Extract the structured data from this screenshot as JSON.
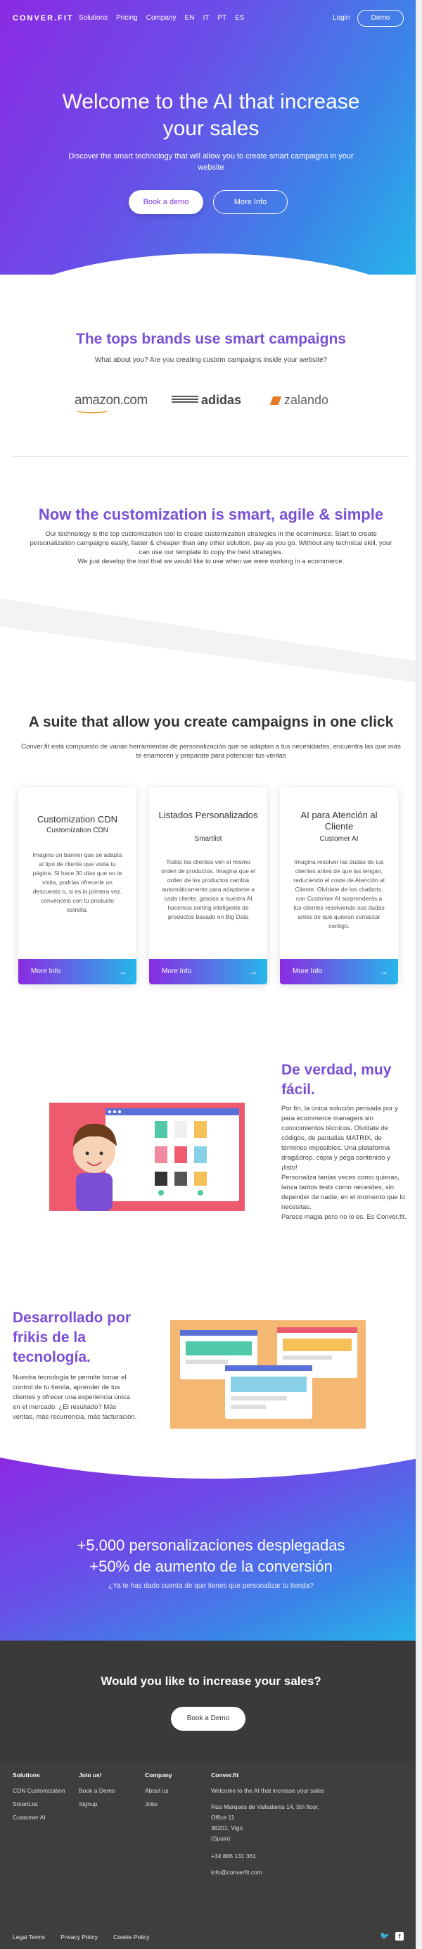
{
  "nav": {
    "logo": "CONVER.FIT",
    "links": [
      "Solutions",
      "Pricing",
      "Company",
      "EN",
      "IT",
      "PT",
      "ES"
    ],
    "login": "Login",
    "demo": "Demo"
  },
  "hero": {
    "title": "Welcome to the AI that increase your sales",
    "subtitle": "Discover the smart technology that will allow you to create smart campaigns in your website",
    "primary_button": "Book a demo",
    "secondary_button": "More Info"
  },
  "brands": {
    "title": "The tops brands use smart campaigns",
    "subtitle": "What about you? Are you creating custom campaigns inside your website?",
    "logos": [
      "amazon.com",
      "adidas",
      "zalando"
    ]
  },
  "customization": {
    "title": "Now the customization is smart, agile & simple",
    "text": "Our technology is the top customization tool to create customization strategies in the ecommerce. Start to create personalization campaigns easily, faster & cheaper than any other solution, pay as you go. Without any technical skill, your can use our template to copy the best strategies.",
    "text2": "We just develop the tool that we would like to use when we were working in a ecommerce."
  },
  "suite": {
    "title": "A suite that allow you create campaigns in one click",
    "subtitle": "Conver.fit está compuesto de varias herramientas de personalización que se adaptan a tus necesidades, encuentra las que más te enamoren y preparate para potenciar tus ventas",
    "cards": [
      {
        "title": "Customization CDN",
        "subtitle": "Customization CDN",
        "text": "Imagina un banner que se adapta al tipo de cliente que visita tu página. Si hace 30 días que no te visita, podrías ofrecerle un descuento o, si es la primera vez, convéncelo con tu producto estrella.",
        "button": "More Info"
      },
      {
        "title": "Listados Personalizados",
        "subtitle": "Smartlist",
        "text": "Todos los clientes ven el mismo orden de productos. Imagina que el orden de los productos cambia automáticamente para adaptarse a cada cliente, gracias a nuestra AI hacemos sorting inteligente de productos basado en Big Data",
        "button": "More Info"
      },
      {
        "title": "AI para Atención al Cliente",
        "subtitle": "Customer AI",
        "text": "Imagina resolver las dudas de tus clientes antes de que las tengan, reduciendo el coste de Atención al Cliente. Olvídate de los chatbots, con Customer AI sorprenderás a tus clientes resolviendo sus dudas antes de que quieran contactar contigo.",
        "button": "More Info"
      }
    ]
  },
  "easy": {
    "title": "De verdad, muy fácil.",
    "p1": "Por fin, la única solución pensada por y para ecommerce managers sin conocimientos técnicos. Olvídate de códigos, de pantallas MATRIX, de términos imposibles. Una plataforma drag&drop, copia y pega contenido y ¡listo!",
    "p2": "Personaliza tantas veces como quieras, lanza tantos tests como necesites, sin depender de nadie, en el momento que lo necesitas.",
    "p3": "Parece magia pero no lo es. Es Conver.fit."
  },
  "geeks": {
    "title": "Desarrollado por frikis de la tecnología.",
    "text": "Nuestra tecnología te permite tomar el control de tu tienda, aprender de tus clientes y ofrecer una experiencia única en el mercado. ¿El resultado? Más ventas, más recurrencia, más facturación."
  },
  "stats": {
    "line1": "+5.000 personalizaciones desplegadas",
    "line2": "+50% de aumento de la conversión",
    "sub": "¿Ya te has dado cuenta de que tienes que personalizar tu tienda?"
  },
  "cta": {
    "title": "Would you like to increase your sales?",
    "button": "Book a Demo"
  },
  "footer": {
    "solutions": {
      "heading": "Solutions",
      "items": [
        "CDN Customization",
        "SmartList",
        "Customer AI"
      ]
    },
    "join": {
      "heading": "Join us!",
      "items": [
        "Book a Demo",
        "Signup"
      ]
    },
    "company": {
      "heading": "Company",
      "items": [
        "About us",
        "Jobs"
      ]
    },
    "converfit": {
      "heading": "Conver.fit",
      "tagline": "Welcome to the AI that increase your sales",
      "address1": "Rúa Marqués de Valladares 14, 5th floor,",
      "address2": "Office 11",
      "address3": "36201, Vigo",
      "address4": "(Spain)",
      "phone": "+34 886 131 361",
      "email": "info@converfit.com"
    },
    "bottom_links": [
      "Legal Terms",
      "Privacy Policy",
      "Cookie Policy"
    ]
  },
  "colors": {
    "purple": "#7a4fd6",
    "gradient_start": "#8a2be2",
    "gradient_end": "#26b6ea",
    "dark_footer": "#3e3e3e"
  }
}
